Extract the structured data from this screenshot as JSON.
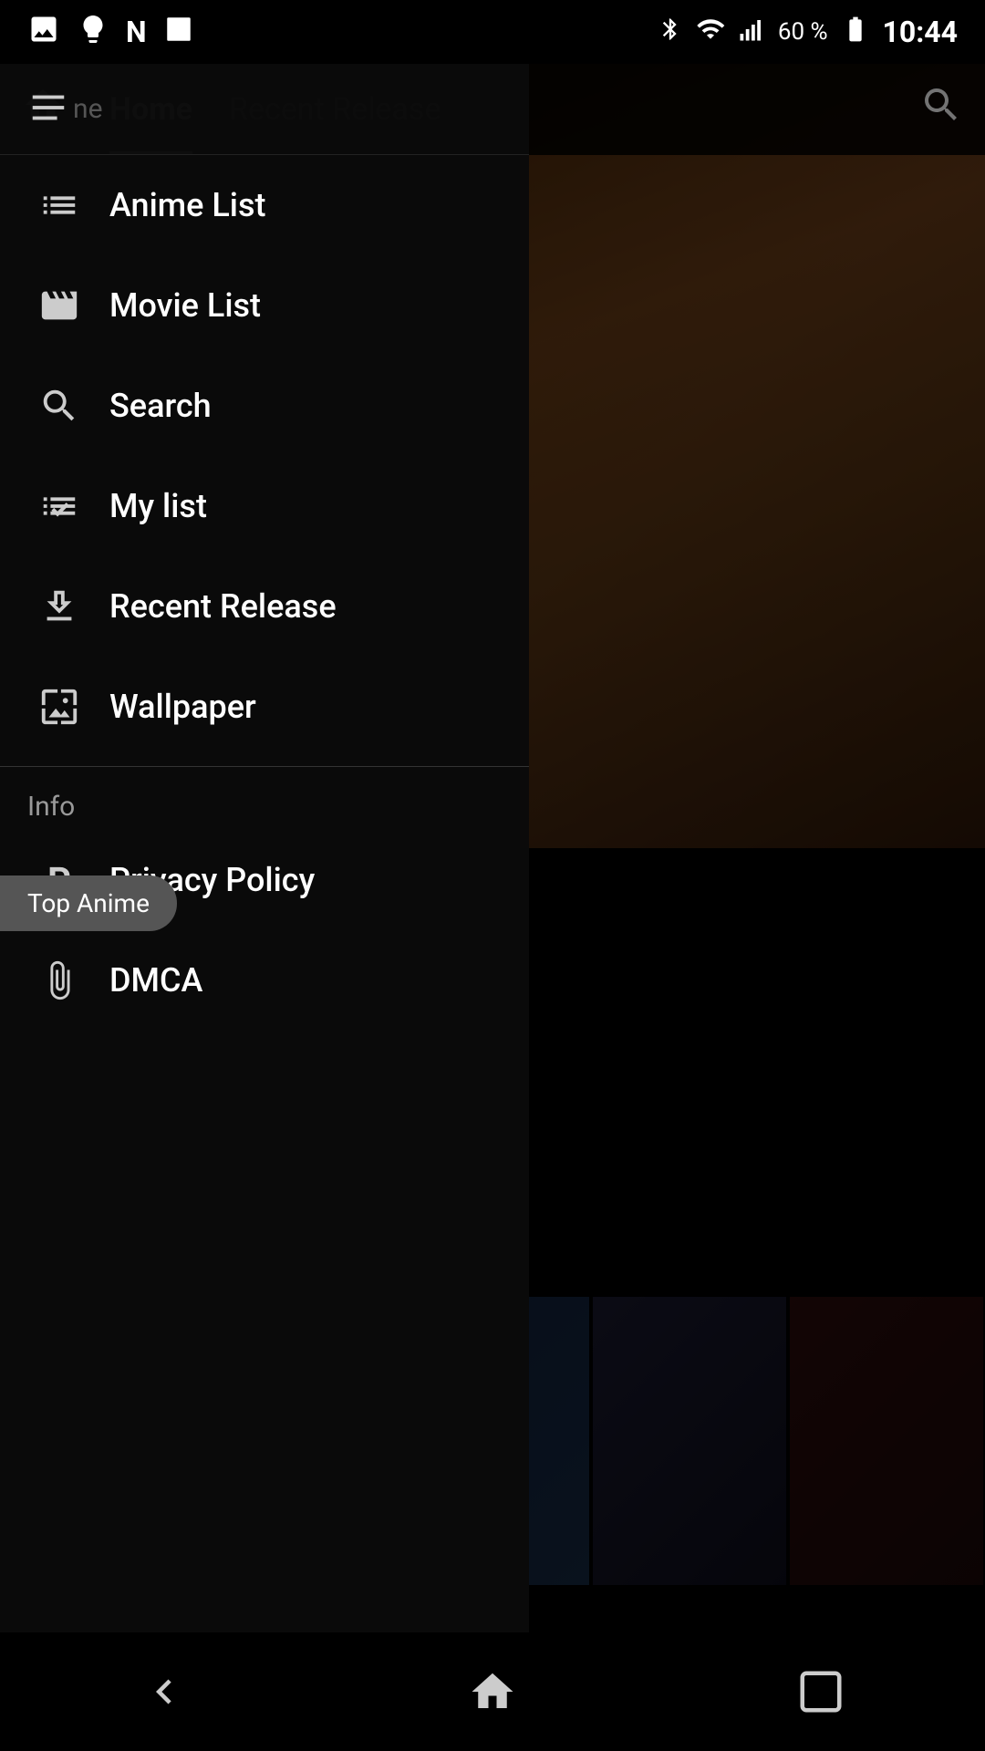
{
  "statusBar": {
    "time": "10:44",
    "battery": "60 %",
    "icons": [
      "bluetooth",
      "wifi",
      "signal",
      "battery"
    ]
  },
  "header": {
    "homeIcon": "🏠",
    "tabs": [
      {
        "label": "Home",
        "active": true
      },
      {
        "label": "Recent Release",
        "active": false
      }
    ],
    "searchIcon": "🔍"
  },
  "drawer": {
    "items": [
      {
        "id": "anime-list",
        "icon": "list",
        "label": "Anime List"
      },
      {
        "id": "movie-list",
        "icon": "film",
        "label": "Movie List"
      },
      {
        "id": "search",
        "icon": "search",
        "label": "Search"
      },
      {
        "id": "my-list",
        "icon": "mylist",
        "label": "My list"
      },
      {
        "id": "recent-release",
        "icon": "download",
        "label": "Recent Release"
      },
      {
        "id": "wallpaper",
        "icon": "wallpaper",
        "label": "Wallpaper"
      }
    ],
    "sectionInfo": "Info",
    "infoItems": [
      {
        "id": "privacy-policy",
        "icon": "P",
        "label": "Privacy Policy"
      },
      {
        "id": "dmca",
        "icon": "clip",
        "label": "DMCA"
      }
    ]
  },
  "badges": {
    "topAnime": "Top Anime"
  },
  "bottomNav": {
    "back": "◁",
    "home": "⌂",
    "recents": "▢"
  }
}
